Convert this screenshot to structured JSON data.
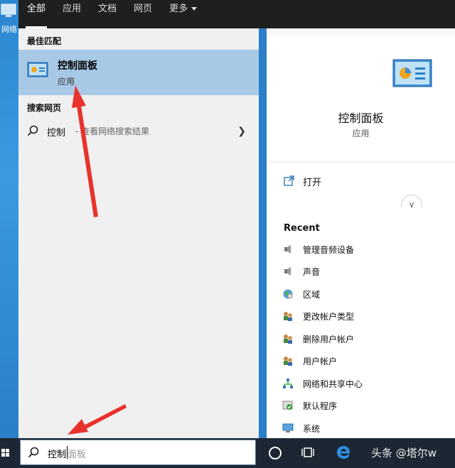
{
  "desktop": {
    "icon_label": "网络"
  },
  "tabs": [
    {
      "label": "全部",
      "active": true
    },
    {
      "label": "应用"
    },
    {
      "label": "文档"
    },
    {
      "label": "网页"
    },
    {
      "label": "更多"
    }
  ],
  "left": {
    "best_match_title": "最佳匹配",
    "best_match": {
      "name": "控制面板",
      "type": "应用"
    },
    "web_title": "搜索网页",
    "web_query": "控制",
    "web_suffix": "- 查看网络搜索结果"
  },
  "right": {
    "title": "控制面板",
    "subtitle": "应用",
    "open_label": "打开",
    "recent_title": "Recent",
    "recent_items": [
      {
        "label": "管理音频设备",
        "icon": "speaker-icon"
      },
      {
        "label": "声音",
        "icon": "speaker-icon"
      },
      {
        "label": "区域",
        "icon": "globe-icon"
      },
      {
        "label": "更改帐户类型",
        "icon": "users-icon"
      },
      {
        "label": "删除用户帐户",
        "icon": "users-icon"
      },
      {
        "label": "用户帐户",
        "icon": "users-icon"
      },
      {
        "label": "网络和共享中心",
        "icon": "network-icon"
      },
      {
        "label": "默认程序",
        "icon": "default-programs-icon"
      },
      {
        "label": "系统",
        "icon": "monitor-icon"
      }
    ]
  },
  "taskbar": {
    "search_typed": "控制",
    "search_ghost": "面板",
    "watermark": "头条 @塔尔w"
  },
  "colors": {
    "best_match_bg": "#a8c9e6",
    "topbar_bg": "#1f1f1f",
    "taskbar_bg": "#1c2733",
    "arrow": "#e8322b"
  }
}
